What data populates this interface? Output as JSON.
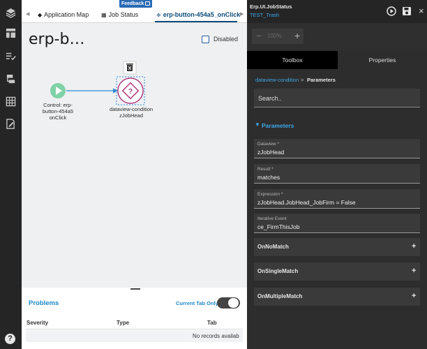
{
  "feedback": {
    "label": "Feedback"
  },
  "tabs": [
    {
      "label": "Application Map",
      "icon": "layers-icon"
    },
    {
      "label": "Job Status",
      "icon": "grid-icon"
    },
    {
      "label": "erp-button-454a5_onClick",
      "icon": "flow-icon",
      "active": true
    }
  ],
  "canvas": {
    "title": "erp-b…",
    "disabled_label": "Disabled",
    "nodes": [
      {
        "label_lines": [
          "Control: erp-",
          "button-454a5",
          "onClick"
        ],
        "type": "start"
      },
      {
        "label_lines": [
          "dataview-condition",
          "zJobHead"
        ],
        "type": "condition"
      }
    ]
  },
  "problems": {
    "title": "Problems",
    "current_tab_only": "Current Tab Only",
    "columns": [
      "Severity",
      "Type",
      "Tab"
    ],
    "empty_message": "No records availab"
  },
  "right_panel": {
    "app_name": "Erp.UI.JobStatus",
    "layer_name": "TEST_Trash",
    "zoom": "100%",
    "tabs": [
      "Toolbox",
      "Properties"
    ],
    "breadcrumb": {
      "link": "dataview-condition",
      "separator": ">",
      "current": "Parameters"
    },
    "search_placeholder": "Search..",
    "section_title": "Parameters",
    "fields": [
      {
        "label": "Dataview *",
        "value": "zJobHead"
      },
      {
        "label": "Result *",
        "value": "matches"
      },
      {
        "label": "Expression *",
        "value": "zJobHead.JobHead_JobFirm = False"
      },
      {
        "label": "Iterative Event",
        "value": "ce_FirmThisJob"
      }
    ],
    "groups": [
      "OnNoMatch",
      "OnSingleMatch",
      "OnMultipleMatch"
    ]
  },
  "help_label": "?",
  "colors": {
    "accent_blue": "#3ea6e8",
    "start_node": "#7fd1a6",
    "condition_node": "#b03c7e",
    "connector": "#2e8bd4"
  }
}
